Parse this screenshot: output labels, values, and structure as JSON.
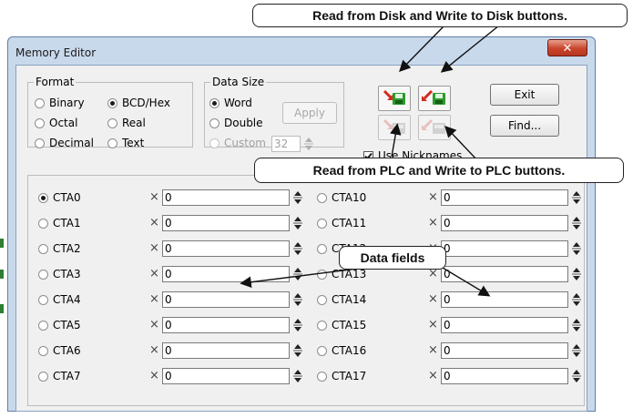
{
  "window": {
    "title": "Memory Editor",
    "close_icon": "close-icon"
  },
  "format": {
    "legend": "Format",
    "options": [
      "Binary",
      "BCD/Hex",
      "Octal",
      "Real",
      "Decimal",
      "Text"
    ],
    "selected": "BCD/Hex"
  },
  "data_size": {
    "legend": "Data Size",
    "options": [
      "Word",
      "Double",
      "Custom"
    ],
    "selected": "Word",
    "custom_value": "32",
    "apply_label": "Apply"
  },
  "buttons": {
    "exit_label": "Exit",
    "find_label": "Find..."
  },
  "use_nicknames": {
    "label": "Use Nicknames",
    "checked": true
  },
  "rows_left": [
    {
      "label": "CTA0",
      "value": "0",
      "selected": true
    },
    {
      "label": "CTA1",
      "value": "0"
    },
    {
      "label": "CTA2",
      "value": "0"
    },
    {
      "label": "CTA3",
      "value": "0"
    },
    {
      "label": "CTA4",
      "value": "0"
    },
    {
      "label": "CTA5",
      "value": "0"
    },
    {
      "label": "CTA6",
      "value": "0"
    },
    {
      "label": "CTA7",
      "value": "0"
    }
  ],
  "rows_right": [
    {
      "label": "CTA10",
      "value": "0"
    },
    {
      "label": "CTA11",
      "value": "0"
    },
    {
      "label": "CTA12",
      "value": "0"
    },
    {
      "label": "CTA13",
      "value": "0"
    },
    {
      "label": "CTA14",
      "value": "0"
    },
    {
      "label": "CTA15",
      "value": "0"
    },
    {
      "label": "CTA16",
      "value": "0"
    },
    {
      "label": "CTA17",
      "value": "0"
    }
  ],
  "multiplier_symbol": "×",
  "callouts": {
    "disk": "Read from Disk and Write to Disk buttons.",
    "plc": "Read from PLC and Write to PLC buttons.",
    "fields": "Data fields"
  },
  "colors": {
    "accent_red": "#d42a1c",
    "accent_green": "#2d9a2d",
    "title_bar": "#c9d9ec"
  }
}
